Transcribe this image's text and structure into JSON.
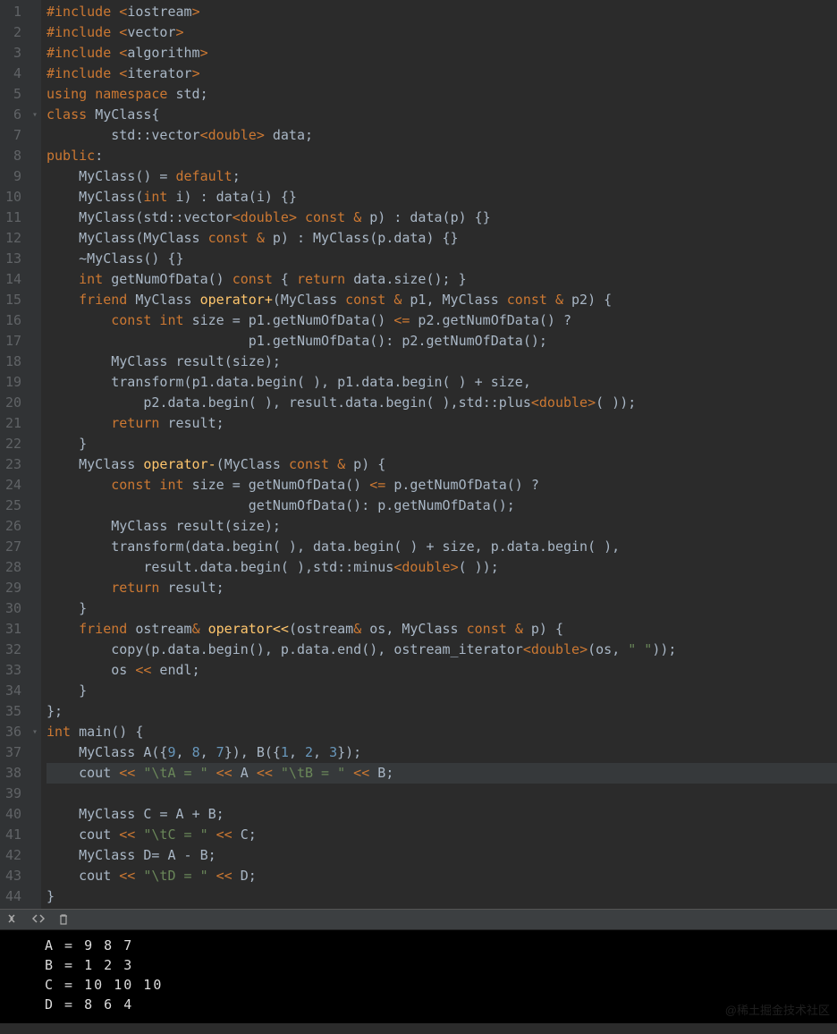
{
  "lineCount": 44,
  "foldMarks": {
    "6": "▾",
    "36": "▾"
  },
  "currentLine": 38,
  "code": {
    "1": [
      [
        "k-pre",
        "#include "
      ],
      [
        "k-ang",
        "<"
      ],
      [
        "k-inc",
        "iostream"
      ],
      [
        "k-ang",
        ">"
      ]
    ],
    "2": [
      [
        "k-pre",
        "#include "
      ],
      [
        "k-ang",
        "<"
      ],
      [
        "k-inc",
        "vector"
      ],
      [
        "k-ang",
        ">"
      ]
    ],
    "3": [
      [
        "k-pre",
        "#include "
      ],
      [
        "k-ang",
        "<"
      ],
      [
        "k-inc",
        "algorithm"
      ],
      [
        "k-ang",
        ">"
      ]
    ],
    "4": [
      [
        "k-pre",
        "#include "
      ],
      [
        "k-ang",
        "<"
      ],
      [
        "k-inc",
        "iterator"
      ],
      [
        "k-ang",
        ">"
      ]
    ],
    "5": [
      [
        "k-kw",
        "using "
      ],
      [
        "k-kw",
        "namespace "
      ],
      [
        "k-id",
        "std"
      ],
      [
        "k-pun",
        ";"
      ]
    ],
    "6": [
      [
        "k-kw",
        "class "
      ],
      [
        "k-id",
        "MyClass"
      ],
      [
        "k-pun",
        "{"
      ]
    ],
    "7": [
      [
        "k-id",
        "        std"
      ],
      [
        "k-pun",
        "::"
      ],
      [
        "k-id",
        "vector"
      ],
      [
        "k-ang",
        "<"
      ],
      [
        "k-kw",
        "double"
      ],
      [
        "k-ang",
        ">"
      ],
      [
        "k-id",
        " data"
      ],
      [
        "k-pun",
        ";"
      ]
    ],
    "8": [
      [
        "k-kw",
        "public"
      ],
      [
        "k-pun",
        ":"
      ]
    ],
    "9": [
      [
        "k-id",
        "    MyClass"
      ],
      [
        "k-pun",
        "() = "
      ],
      [
        "k-kw",
        "default"
      ],
      [
        "k-pun",
        ";"
      ]
    ],
    "10": [
      [
        "k-id",
        "    MyClass"
      ],
      [
        "k-pun",
        "("
      ],
      [
        "k-kw",
        "int"
      ],
      [
        "k-id",
        " i"
      ],
      [
        "k-pun",
        ") : "
      ],
      [
        "k-id",
        "data"
      ],
      [
        "k-pun",
        "("
      ],
      [
        "k-id",
        "i"
      ],
      [
        "k-pun",
        ") {}"
      ]
    ],
    "11": [
      [
        "k-id",
        "    MyClass"
      ],
      [
        "k-pun",
        "("
      ],
      [
        "k-id",
        "std"
      ],
      [
        "k-pun",
        "::"
      ],
      [
        "k-id",
        "vector"
      ],
      [
        "k-ang",
        "<"
      ],
      [
        "k-kw",
        "double"
      ],
      [
        "k-ang",
        ">"
      ],
      [
        "k-kw",
        " const "
      ],
      [
        "k-ang",
        "&"
      ],
      [
        "k-id",
        " p"
      ],
      [
        "k-pun",
        ") : "
      ],
      [
        "k-id",
        "data"
      ],
      [
        "k-pun",
        "("
      ],
      [
        "k-id",
        "p"
      ],
      [
        "k-pun",
        ") {}"
      ]
    ],
    "12": [
      [
        "k-id",
        "    MyClass"
      ],
      [
        "k-pun",
        "("
      ],
      [
        "k-id",
        "MyClass "
      ],
      [
        "k-kw",
        "const "
      ],
      [
        "k-ang",
        "&"
      ],
      [
        "k-id",
        " p"
      ],
      [
        "k-pun",
        ") : "
      ],
      [
        "k-id",
        "MyClass"
      ],
      [
        "k-pun",
        "("
      ],
      [
        "k-id",
        "p"
      ],
      [
        "k-pun",
        "."
      ],
      [
        "k-id",
        "data"
      ],
      [
        "k-pun",
        ") {}"
      ]
    ],
    "13": [
      [
        "k-pun",
        "    ~"
      ],
      [
        "k-id",
        "MyClass"
      ],
      [
        "k-pun",
        "() {}"
      ]
    ],
    "14": [
      [
        "k-kw",
        "    int "
      ],
      [
        "k-id",
        "getNumOfData"
      ],
      [
        "k-pun",
        "() "
      ],
      [
        "k-kw",
        "const "
      ],
      [
        "k-pun",
        "{ "
      ],
      [
        "k-kw",
        "return "
      ],
      [
        "k-id",
        "data"
      ],
      [
        "k-pun",
        "."
      ],
      [
        "k-id",
        "size"
      ],
      [
        "k-pun",
        "(); }"
      ]
    ],
    "15": [
      [
        "k-kw",
        "    friend "
      ],
      [
        "k-id",
        "MyClass "
      ],
      [
        "k-fn",
        "operator+"
      ],
      [
        "k-pun",
        "("
      ],
      [
        "k-id",
        "MyClass "
      ],
      [
        "k-kw",
        "const "
      ],
      [
        "k-ang",
        "&"
      ],
      [
        "k-id",
        " p1"
      ],
      [
        "k-pun",
        ", "
      ],
      [
        "k-id",
        "MyClass "
      ],
      [
        "k-kw",
        "const "
      ],
      [
        "k-ang",
        "&"
      ],
      [
        "k-id",
        " p2"
      ],
      [
        "k-pun",
        ") {"
      ]
    ],
    "16": [
      [
        "k-kw",
        "        const int "
      ],
      [
        "k-id",
        "size "
      ],
      [
        "k-pun",
        "= "
      ],
      [
        "k-id",
        "p1"
      ],
      [
        "k-pun",
        "."
      ],
      [
        "k-id",
        "getNumOfData"
      ],
      [
        "k-pun",
        "() "
      ],
      [
        "k-ang",
        "<="
      ],
      [
        "k-id",
        " p2"
      ],
      [
        "k-pun",
        "."
      ],
      [
        "k-id",
        "getNumOfData"
      ],
      [
        "k-pun",
        "() ?"
      ]
    ],
    "17": [
      [
        "k-id",
        "                         p1"
      ],
      [
        "k-pun",
        "."
      ],
      [
        "k-id",
        "getNumOfData"
      ],
      [
        "k-pun",
        "(): "
      ],
      [
        "k-id",
        "p2"
      ],
      [
        "k-pun",
        "."
      ],
      [
        "k-id",
        "getNumOfData"
      ],
      [
        "k-pun",
        "();"
      ]
    ],
    "18": [
      [
        "k-id",
        "        MyClass result"
      ],
      [
        "k-pun",
        "("
      ],
      [
        "k-id",
        "size"
      ],
      [
        "k-pun",
        ");"
      ]
    ],
    "19": [
      [
        "k-id",
        "        transform"
      ],
      [
        "k-pun",
        "("
      ],
      [
        "k-id",
        "p1"
      ],
      [
        "k-pun",
        "."
      ],
      [
        "k-id",
        "data"
      ],
      [
        "k-pun",
        "."
      ],
      [
        "k-id",
        "begin"
      ],
      [
        "k-pun",
        "( ), "
      ],
      [
        "k-id",
        "p1"
      ],
      [
        "k-pun",
        "."
      ],
      [
        "k-id",
        "data"
      ],
      [
        "k-pun",
        "."
      ],
      [
        "k-id",
        "begin"
      ],
      [
        "k-pun",
        "( ) + "
      ],
      [
        "k-id",
        "size"
      ],
      [
        "k-pun",
        ","
      ]
    ],
    "20": [
      [
        "k-id",
        "            p2"
      ],
      [
        "k-pun",
        "."
      ],
      [
        "k-id",
        "data"
      ],
      [
        "k-pun",
        "."
      ],
      [
        "k-id",
        "begin"
      ],
      [
        "k-pun",
        "( ), "
      ],
      [
        "k-id",
        "result"
      ],
      [
        "k-pun",
        "."
      ],
      [
        "k-id",
        "data"
      ],
      [
        "k-pun",
        "."
      ],
      [
        "k-id",
        "begin"
      ],
      [
        "k-pun",
        "( ),"
      ],
      [
        "k-id",
        "std"
      ],
      [
        "k-pun",
        "::"
      ],
      [
        "k-id",
        "plus"
      ],
      [
        "k-ang",
        "<"
      ],
      [
        "k-kw",
        "double"
      ],
      [
        "k-ang",
        ">"
      ],
      [
        "k-pun",
        "( ));"
      ]
    ],
    "21": [
      [
        "k-kw",
        "        return "
      ],
      [
        "k-id",
        "result"
      ],
      [
        "k-pun",
        ";"
      ]
    ],
    "22": [
      [
        "k-pun",
        "    }"
      ]
    ],
    "23": [
      [
        "k-id",
        "    MyClass "
      ],
      [
        "k-fn",
        "operator-"
      ],
      [
        "k-pun",
        "("
      ],
      [
        "k-id",
        "MyClass "
      ],
      [
        "k-kw",
        "const "
      ],
      [
        "k-ang",
        "&"
      ],
      [
        "k-id",
        " p"
      ],
      [
        "k-pun",
        ") {"
      ]
    ],
    "24": [
      [
        "k-kw",
        "        const int "
      ],
      [
        "k-id",
        "size "
      ],
      [
        "k-pun",
        "= "
      ],
      [
        "k-id",
        "getNumOfData"
      ],
      [
        "k-pun",
        "() "
      ],
      [
        "k-ang",
        "<="
      ],
      [
        "k-id",
        " p"
      ],
      [
        "k-pun",
        "."
      ],
      [
        "k-id",
        "getNumOfData"
      ],
      [
        "k-pun",
        "() ?"
      ]
    ],
    "25": [
      [
        "k-id",
        "                         getNumOfData"
      ],
      [
        "k-pun",
        "(): "
      ],
      [
        "k-id",
        "p"
      ],
      [
        "k-pun",
        "."
      ],
      [
        "k-id",
        "getNumOfData"
      ],
      [
        "k-pun",
        "();"
      ]
    ],
    "26": [
      [
        "k-id",
        "        MyClass result"
      ],
      [
        "k-pun",
        "("
      ],
      [
        "k-id",
        "size"
      ],
      [
        "k-pun",
        ");"
      ]
    ],
    "27": [
      [
        "k-id",
        "        transform"
      ],
      [
        "k-pun",
        "("
      ],
      [
        "k-id",
        "data"
      ],
      [
        "k-pun",
        "."
      ],
      [
        "k-id",
        "begin"
      ],
      [
        "k-pun",
        "( ), "
      ],
      [
        "k-id",
        "data"
      ],
      [
        "k-pun",
        "."
      ],
      [
        "k-id",
        "begin"
      ],
      [
        "k-pun",
        "( ) + "
      ],
      [
        "k-id",
        "size"
      ],
      [
        "k-pun",
        ", "
      ],
      [
        "k-id",
        "p"
      ],
      [
        "k-pun",
        "."
      ],
      [
        "k-id",
        "data"
      ],
      [
        "k-pun",
        "."
      ],
      [
        "k-id",
        "begin"
      ],
      [
        "k-pun",
        "( ),"
      ]
    ],
    "28": [
      [
        "k-id",
        "            result"
      ],
      [
        "k-pun",
        "."
      ],
      [
        "k-id",
        "data"
      ],
      [
        "k-pun",
        "."
      ],
      [
        "k-id",
        "begin"
      ],
      [
        "k-pun",
        "( ),"
      ],
      [
        "k-id",
        "std"
      ],
      [
        "k-pun",
        "::"
      ],
      [
        "k-id",
        "minus"
      ],
      [
        "k-ang",
        "<"
      ],
      [
        "k-kw",
        "double"
      ],
      [
        "k-ang",
        ">"
      ],
      [
        "k-pun",
        "( ));"
      ]
    ],
    "29": [
      [
        "k-kw",
        "        return "
      ],
      [
        "k-id",
        "result"
      ],
      [
        "k-pun",
        ";"
      ]
    ],
    "30": [
      [
        "k-pun",
        "    }"
      ]
    ],
    "31": [
      [
        "k-kw",
        "    friend "
      ],
      [
        "k-id",
        "ostream"
      ],
      [
        "k-ang",
        "& "
      ],
      [
        "k-fn",
        "operator<<"
      ],
      [
        "k-pun",
        "("
      ],
      [
        "k-id",
        "ostream"
      ],
      [
        "k-ang",
        "&"
      ],
      [
        "k-id",
        " os"
      ],
      [
        "k-pun",
        ", "
      ],
      [
        "k-id",
        "MyClass "
      ],
      [
        "k-kw",
        "const "
      ],
      [
        "k-ang",
        "&"
      ],
      [
        "k-id",
        " p"
      ],
      [
        "k-pun",
        ") {"
      ]
    ],
    "32": [
      [
        "k-id",
        "        copy"
      ],
      [
        "k-pun",
        "("
      ],
      [
        "k-id",
        "p"
      ],
      [
        "k-pun",
        "."
      ],
      [
        "k-id",
        "data"
      ],
      [
        "k-pun",
        "."
      ],
      [
        "k-id",
        "begin"
      ],
      [
        "k-pun",
        "(), "
      ],
      [
        "k-id",
        "p"
      ],
      [
        "k-pun",
        "."
      ],
      [
        "k-id",
        "data"
      ],
      [
        "k-pun",
        "."
      ],
      [
        "k-id",
        "end"
      ],
      [
        "k-pun",
        "(), "
      ],
      [
        "k-id",
        "ostream_iterator"
      ],
      [
        "k-ang",
        "<"
      ],
      [
        "k-kw",
        "double"
      ],
      [
        "k-ang",
        ">"
      ],
      [
        "k-pun",
        "("
      ],
      [
        "k-id",
        "os"
      ],
      [
        "k-pun",
        ", "
      ],
      [
        "k-str",
        "\" \""
      ],
      [
        "k-pun",
        "));"
      ]
    ],
    "33": [
      [
        "k-id",
        "        os "
      ],
      [
        "k-ang",
        "<<"
      ],
      [
        "k-id",
        " endl"
      ],
      [
        "k-pun",
        ";"
      ]
    ],
    "34": [
      [
        "k-pun",
        "    }"
      ]
    ],
    "35": [
      [
        "k-pun",
        "};"
      ]
    ],
    "36": [
      [
        "k-kw",
        "int "
      ],
      [
        "k-id",
        "main"
      ],
      [
        "k-pun",
        "() {"
      ]
    ],
    "37": [
      [
        "k-id",
        "    MyClass A"
      ],
      [
        "k-pun",
        "({"
      ],
      [
        "k-num",
        "9"
      ],
      [
        "k-pun",
        ", "
      ],
      [
        "k-num",
        "8"
      ],
      [
        "k-pun",
        ", "
      ],
      [
        "k-num",
        "7"
      ],
      [
        "k-pun",
        "}), "
      ],
      [
        "k-id",
        "B"
      ],
      [
        "k-pun",
        "({"
      ],
      [
        "k-num",
        "1"
      ],
      [
        "k-pun",
        ", "
      ],
      [
        "k-num",
        "2"
      ],
      [
        "k-pun",
        ", "
      ],
      [
        "k-num",
        "3"
      ],
      [
        "k-pun",
        "});"
      ]
    ],
    "38": [
      [
        "k-id",
        "    cout "
      ],
      [
        "k-ang",
        "<< "
      ],
      [
        "k-str",
        "\"\\tA = \""
      ],
      [
        "k-ang",
        " << "
      ],
      [
        "k-id",
        "A "
      ],
      [
        "k-ang",
        "<< "
      ],
      [
        "k-str",
        "\"\\tB = \""
      ],
      [
        "k-ang",
        " << "
      ],
      [
        "k-id",
        "B"
      ],
      [
        "k-pun",
        ";"
      ]
    ],
    "39": [
      [
        "",
        ""
      ]
    ],
    "40": [
      [
        "k-id",
        "    MyClass C "
      ],
      [
        "k-pun",
        "= "
      ],
      [
        "k-id",
        "A "
      ],
      [
        "k-pun",
        "+ "
      ],
      [
        "k-id",
        "B"
      ],
      [
        "k-pun",
        ";"
      ]
    ],
    "41": [
      [
        "k-id",
        "    cout "
      ],
      [
        "k-ang",
        "<< "
      ],
      [
        "k-str",
        "\"\\tC = \""
      ],
      [
        "k-ang",
        " << "
      ],
      [
        "k-id",
        "C"
      ],
      [
        "k-pun",
        ";"
      ]
    ],
    "42": [
      [
        "k-id",
        "    MyClass D"
      ],
      [
        "k-pun",
        "= "
      ],
      [
        "k-id",
        "A "
      ],
      [
        "k-pun",
        "- "
      ],
      [
        "k-id",
        "B"
      ],
      [
        "k-pun",
        ";"
      ]
    ],
    "43": [
      [
        "k-id",
        "    cout "
      ],
      [
        "k-ang",
        "<< "
      ],
      [
        "k-str",
        "\"\\tD = \""
      ],
      [
        "k-ang",
        " << "
      ],
      [
        "k-id",
        "D"
      ],
      [
        "k-pun",
        ";"
      ]
    ],
    "44": [
      [
        "k-pun",
        "}"
      ]
    ]
  },
  "consoleOutput": [
    "A = 9 8 7",
    "B = 1 2 3",
    "C = 10 10 10",
    "D = 8 6 4"
  ],
  "watermark": "@稀土掘金技术社区"
}
